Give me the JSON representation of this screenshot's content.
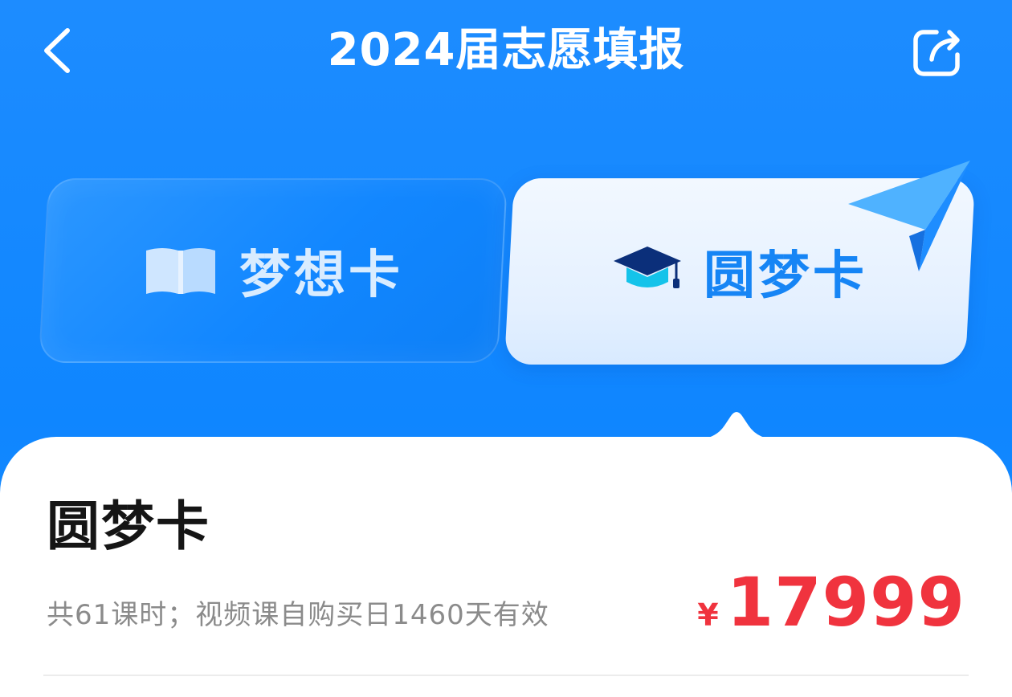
{
  "header": {
    "title": "2024届志愿填报",
    "back_icon": "chevron-left-icon",
    "share_icon": "share-icon"
  },
  "tabs": [
    {
      "label": "梦想卡",
      "icon": "open-book-icon",
      "selected": false
    },
    {
      "label": "圆梦卡",
      "icon": "graduation-cap-icon",
      "selected": true
    }
  ],
  "card": {
    "title": "圆梦卡",
    "description": "共61课时；视频课自购买日1460天有效",
    "price_currency": "¥",
    "price_amount": "17999"
  },
  "colors": {
    "primary_blue": "#1689ff",
    "price_red": "#f0333e",
    "muted_text": "#8b8b8b"
  }
}
